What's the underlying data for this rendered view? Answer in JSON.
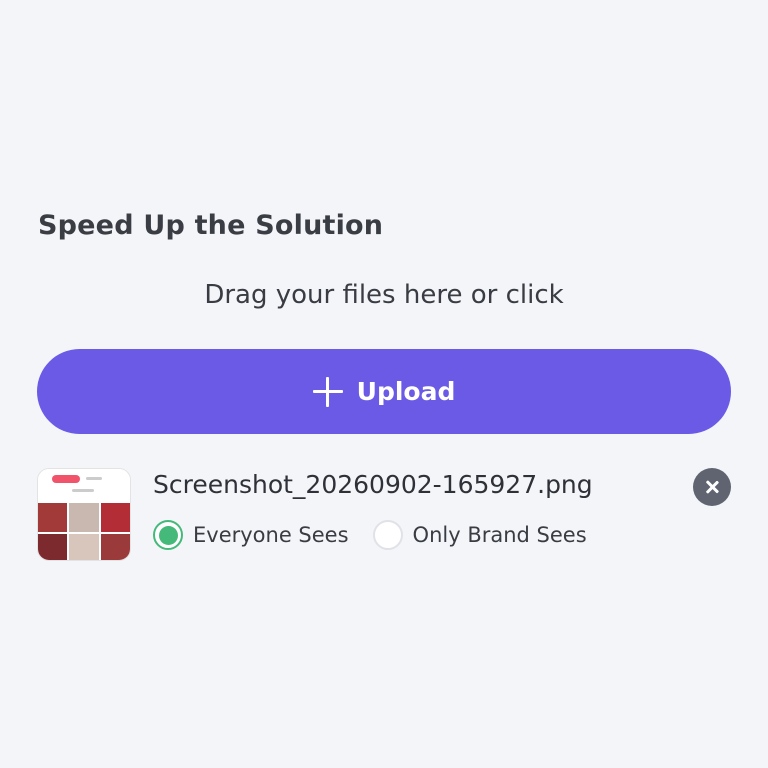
{
  "section": {
    "title": "Speed Up the Solution",
    "drag_hint": "Drag your files here or click"
  },
  "upload": {
    "label": "Upload",
    "icon": "plus-icon",
    "color": "#6a5ae6"
  },
  "file": {
    "name": "Screenshot_20260902-165927.png",
    "thumbnail_icon": "image-thumbnail",
    "remove_icon": "close-icon",
    "visibility": {
      "selected": "Everyone Sees",
      "options": [
        "Everyone Sees",
        "Only Brand Sees"
      ],
      "selected_color": "#45b97a"
    }
  }
}
